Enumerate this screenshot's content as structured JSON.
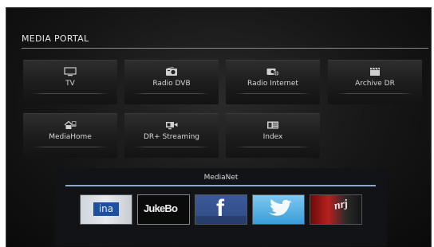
{
  "portal": {
    "title": "MEDIA PORTAL"
  },
  "tiles": [
    {
      "label": "TV",
      "icon": "tv-icon"
    },
    {
      "label": "Radio DVB",
      "icon": "radio-icon"
    },
    {
      "label": "Radio Internet",
      "icon": "internet-radio-icon"
    },
    {
      "label": "Archive DR",
      "icon": "archive-icon"
    },
    {
      "label": "MediaHome",
      "icon": "media-home-icon"
    },
    {
      "label": "DR+ Streaming",
      "icon": "streaming-icon"
    },
    {
      "label": "Index",
      "icon": "index-icon"
    }
  ],
  "medianet": {
    "title": "MediaNet",
    "apps": [
      {
        "name": "ina",
        "logo": "ina"
      },
      {
        "name": "JukeBox",
        "logo": "JukeBo"
      },
      {
        "name": "Facebook",
        "logo": "f"
      },
      {
        "name": "Twitter",
        "logo": ""
      },
      {
        "name": "NRJ",
        "logo": "nrj"
      }
    ]
  },
  "colors": {
    "accent_rule": "#8fa6c4",
    "background": "#161616",
    "text": "#d6d6d6"
  }
}
